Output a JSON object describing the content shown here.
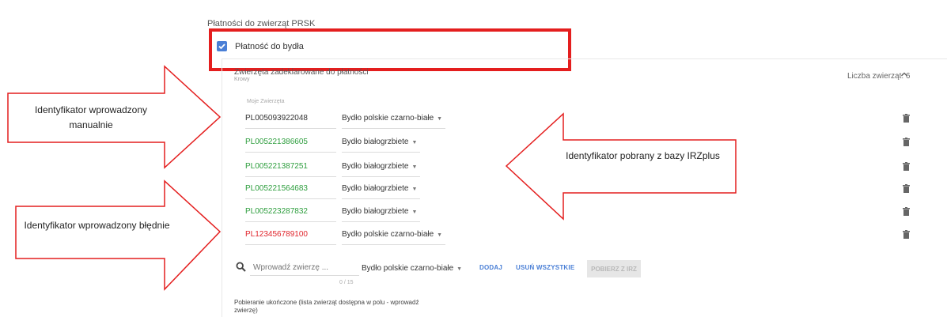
{
  "section": {
    "title": "Płatności do zwierząt PRSK"
  },
  "checkbox": {
    "label": "Płatność do bydła",
    "checked": true,
    "color": "#4a7fd6"
  },
  "panel": {
    "title": "Zwierzęta zadeklarowane do płatności",
    "subtitle": "Krowy",
    "count_label": "Liczba zwierząt: 6",
    "list_label": "Moje Zwierzęta"
  },
  "animals": [
    {
      "id": "PL005093922048",
      "breed": "Bydło polskie czarno-białe",
      "status": "manual"
    },
    {
      "id": "PL005221386605",
      "breed": "Bydło białogrzbiete",
      "status": "irz"
    },
    {
      "id": "PL005221387251",
      "breed": "Bydło białogrzbiete",
      "status": "irz"
    },
    {
      "id": "PL005221564683",
      "breed": "Bydło białogrzbiete",
      "status": "irz"
    },
    {
      "id": "PL005223287832",
      "breed": "Bydło białogrzbiete",
      "status": "irz"
    },
    {
      "id": "PL123456789100",
      "breed": "Bydło polskie czarno-białe",
      "status": "error"
    }
  ],
  "status_colors": {
    "manual": "#333333",
    "irz": "#2e9e3e",
    "error": "#e0242b"
  },
  "add_row": {
    "placeholder": "Wprowadź zwierzę ...",
    "counter": "0 / 15",
    "breed": "Bydło polskie czarno-białe",
    "add_label": "DODAJ",
    "remove_all_label": "USUŃ WSZYSTKIE",
    "fetch_irz_label": "POBIERZ Z IRZ"
  },
  "status_note": "Pobieranie ukończone (lista zwierząt dostępna w polu - wprowadź zwierzę)",
  "annotations": {
    "manual": "Identyfikator wprowadzony manualnie",
    "irz": "Identyfikator pobrany z bazy IRZplus",
    "error": "Identyfikator wprowadzony błędnie"
  },
  "annotation_color": "#e41e1e"
}
